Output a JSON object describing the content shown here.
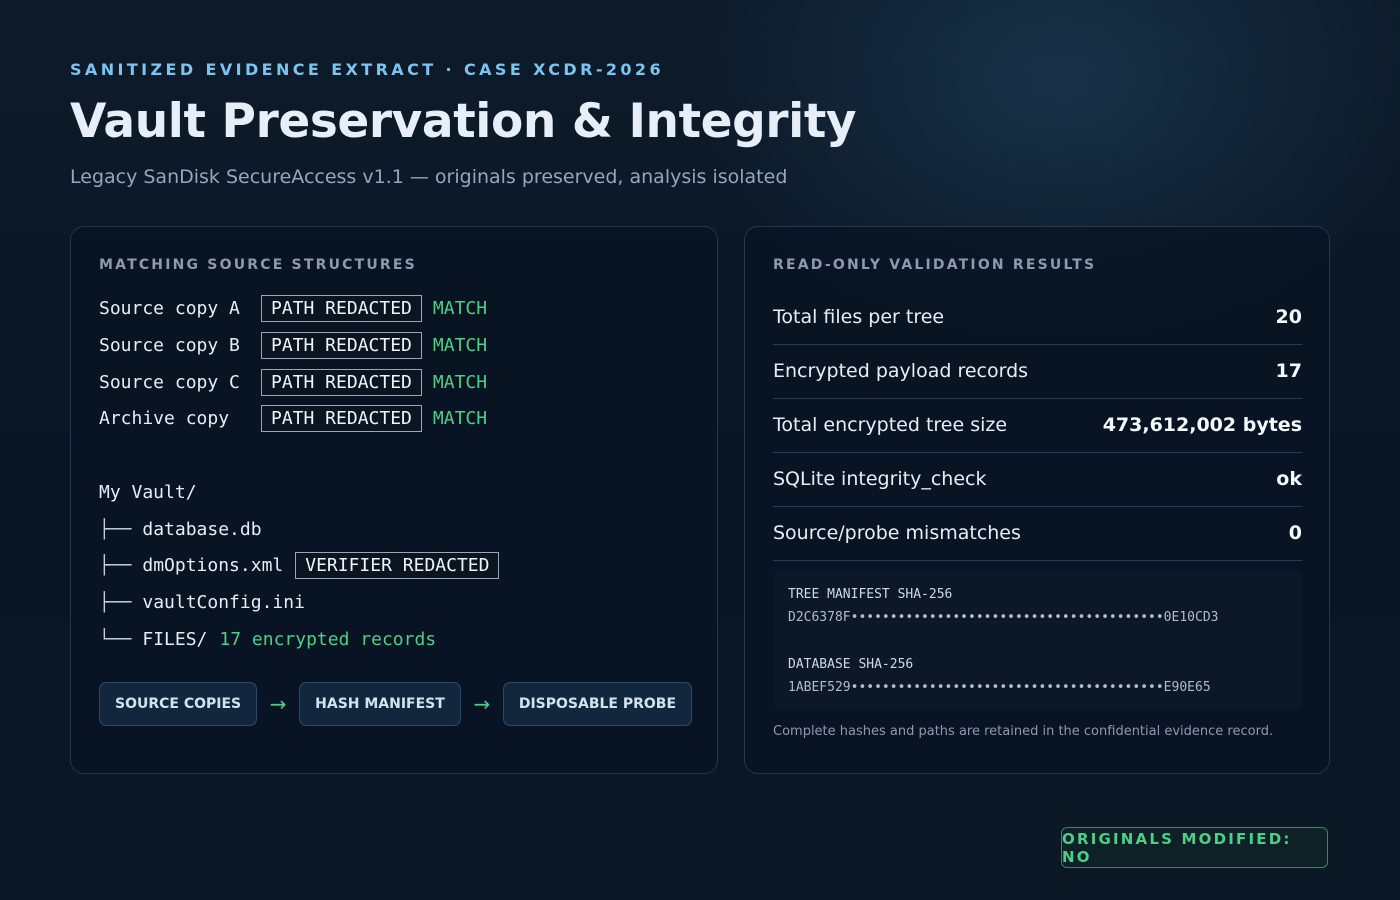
{
  "header": {
    "kicker": "SANITIZED EVIDENCE EXTRACT · CASE XCDR-2026",
    "title": "Vault Preservation & Integrity",
    "subtitle": "Legacy SanDisk SecureAccess v1.1 — originals preserved, analysis isolated"
  },
  "left_panel": {
    "heading": "MATCHING SOURCE STRUCTURES",
    "sources": [
      {
        "label": "Source copy A",
        "path": "PATH REDACTED",
        "status": "MATCH"
      },
      {
        "label": "Source copy B",
        "path": "PATH REDACTED",
        "status": "MATCH"
      },
      {
        "label": "Source copy C",
        "path": "PATH REDACTED",
        "status": "MATCH"
      },
      {
        "label": "Archive copy",
        "path": "PATH REDACTED",
        "status": "MATCH"
      }
    ],
    "tree": {
      "root": "My Vault/",
      "items": [
        {
          "branch": "├──",
          "name": "database.db"
        },
        {
          "branch": "├──",
          "name": "dmOptions.xml",
          "redaction": "VERIFIER REDACTED"
        },
        {
          "branch": "├──",
          "name": "vaultConfig.ini"
        },
        {
          "branch": "└──",
          "name": "FILES/",
          "note": "17 encrypted records"
        }
      ]
    },
    "flow": [
      "SOURCE COPIES",
      "HASH MANIFEST",
      "DISPOSABLE PROBE"
    ],
    "flow_arrow": "→"
  },
  "right_panel": {
    "heading": "READ-ONLY VALIDATION RESULTS",
    "results": [
      {
        "label": "Total files per tree",
        "value": "20"
      },
      {
        "label": "Encrypted payload records",
        "value": "17"
      },
      {
        "label": "Total encrypted tree size",
        "value": "473,612,002 bytes"
      },
      {
        "label": "SQLite integrity_check",
        "value": "ok"
      },
      {
        "label": "Source/probe mismatches",
        "value": "0"
      }
    ],
    "hashes": [
      {
        "label": "TREE MANIFEST SHA-256",
        "value": "D2C6378F••••••••••••••••••••••••••••••••••••••••0E10CD3"
      },
      {
        "label": "DATABASE SHA-256",
        "value": "1ABEF529••••••••••••••••••••••••••••••••••••••••E90E65"
      }
    ],
    "footnote": "Complete hashes and paths are retained in the confidential evidence record."
  },
  "status": {
    "originals_modified": "ORIGINALS MODIFIED: NO"
  },
  "colors": {
    "accent_blue": "#7cc4f0",
    "match_green": "#4ccf86",
    "panel_border": "#26374a",
    "background": "#0b1826"
  }
}
